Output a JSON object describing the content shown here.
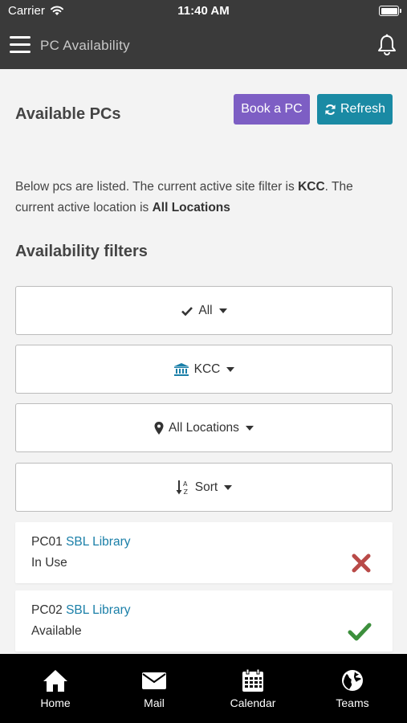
{
  "status_bar": {
    "carrier": "Carrier",
    "time": "11:40 AM"
  },
  "header": {
    "title": "PC Availability"
  },
  "main": {
    "title": "Available PCs",
    "book_label": "Book a PC",
    "refresh_label": "Refresh",
    "description": {
      "part1": "Below pcs are listed. The current active site filter is ",
      "site": "KCC",
      "part2": ". The current active location is ",
      "location": "All Locations"
    },
    "filters_title": "Availability filters",
    "filters": {
      "availability": "All",
      "site": "KCC",
      "location": "All Locations",
      "sort": "Sort"
    }
  },
  "pcs": [
    {
      "name": "PC01",
      "library": "SBL Library",
      "status": "In Use",
      "status_icon": "cross-icon"
    },
    {
      "name": "PC02",
      "library": "SBL Library",
      "status": "Available",
      "status_icon": "check-icon"
    }
  ],
  "colors": {
    "header_bg": "#3a3a3a",
    "book_button": "#7d5ec4",
    "refresh_button": "#1a8aa4",
    "link": "#1a7fa8",
    "in_use": "#b94a48",
    "available": "#3c8f3c"
  },
  "tabs": [
    {
      "label": "Home",
      "icon": "home-icon"
    },
    {
      "label": "Mail",
      "icon": "mail-icon"
    },
    {
      "label": "Calendar",
      "icon": "calendar-icon"
    },
    {
      "label": "Teams",
      "icon": "globe-icon"
    }
  ]
}
